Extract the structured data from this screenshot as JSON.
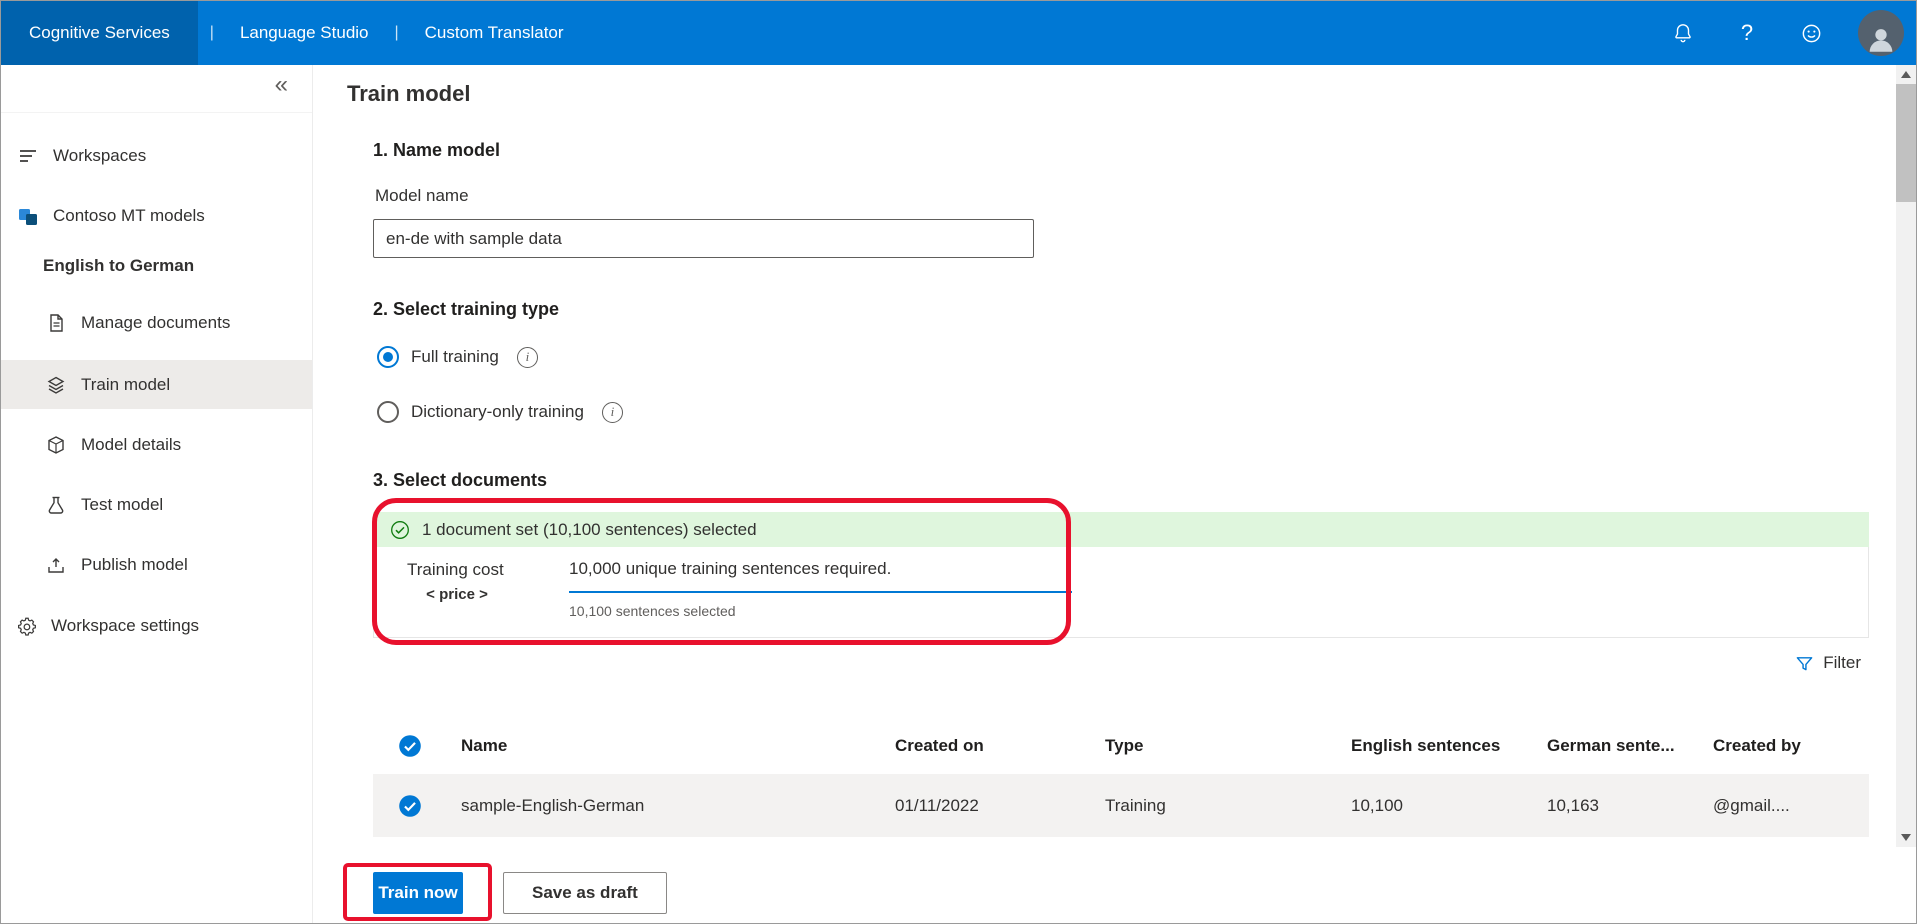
{
  "colors": {
    "topbar": "#0078d4",
    "accent": "#0078d4",
    "banner-bg": "#dff6dd",
    "banner-green": "#107c10",
    "annotation": "#e8112d",
    "row-bg": "#f3f2f1",
    "selected-bg": "#edebe9"
  },
  "topbar": {
    "brand": "Cognitive Services",
    "separator": "|",
    "links": [
      "Language Studio",
      "Custom Translator"
    ],
    "help_glyph": "?"
  },
  "icons": {
    "info_glyph": "i"
  },
  "sidebar": {
    "collapse_glyph": "«",
    "items": [
      {
        "label": "Workspaces"
      },
      {
        "label": "Contoso MT models"
      },
      {
        "label": "English to German"
      },
      {
        "label": "Manage documents"
      },
      {
        "label": "Train model"
      },
      {
        "label": "Model details"
      },
      {
        "label": "Test model"
      },
      {
        "label": "Publish model"
      },
      {
        "label": "Workspace settings"
      }
    ]
  },
  "page": {
    "title": "Train model",
    "name_section": {
      "heading": "1. Name model",
      "field_label": "Model name",
      "field_value": "en-de with sample data"
    },
    "training_type_section": {
      "heading": "2. Select training type",
      "options": [
        {
          "label": "Full training",
          "selected": true
        },
        {
          "label": "Dictionary-only training",
          "selected": false
        }
      ]
    },
    "documents_section": {
      "heading": "3. Select documents",
      "selection_banner": "1 document set (10,100 sentences) selected",
      "training_cost_label": "Training cost",
      "price_placeholder": "< price >",
      "required_sentences": "10,000 unique training sentences required.",
      "selected_sentences": "10,100 sentences selected",
      "filter_label": "Filter"
    },
    "table": {
      "headers": [
        "Name",
        "Created on",
        "Type",
        "English sentences",
        "German sente...",
        "Created by"
      ],
      "rows": [
        {
          "name": "sample-English-German",
          "created_on": "01/11/2022",
          "type": "Training",
          "english_sentences": "10,100",
          "german_sentences": "10,163",
          "created_by": "@gmail...."
        }
      ]
    },
    "actions": {
      "train_now": "Train now",
      "save_as_draft": "Save as draft"
    }
  }
}
